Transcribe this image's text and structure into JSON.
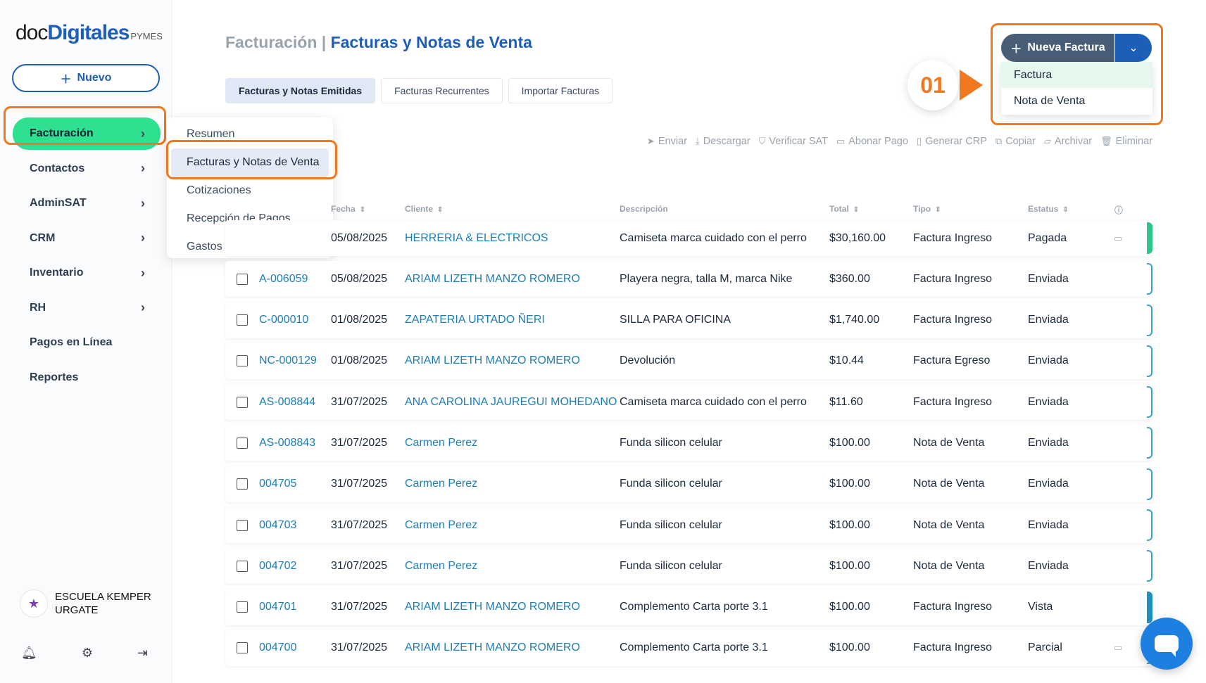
{
  "brand": {
    "pre": "doc",
    "name": "Digitales",
    "suffix": "PYMES"
  },
  "sidebar": {
    "new_button": "Nuevo",
    "items": [
      {
        "label": "Facturación",
        "active": true,
        "chevron": true
      },
      {
        "label": "Contactos",
        "chevron": true
      },
      {
        "label": "AdminSAT",
        "chevron": true
      },
      {
        "label": "CRM",
        "chevron": true
      },
      {
        "label": "Inventario",
        "chevron": true
      },
      {
        "label": "RH",
        "chevron": true
      },
      {
        "label": "Pagos en Línea",
        "chevron": false
      },
      {
        "label": "Reportes",
        "chevron": false
      }
    ],
    "org_name": "ESCUELA KEMPER URGATE",
    "bottom_icons": [
      "bell-icon",
      "gear-icon",
      "logout-icon"
    ]
  },
  "submenu": {
    "items": [
      "Resumen",
      "Facturas y Notas de Venta",
      "Cotizaciones",
      "Recepción de Pagos",
      "Gastos"
    ],
    "active": "Facturas y Notas de Venta"
  },
  "header": {
    "crumb": "Facturación",
    "separator": "|",
    "title": "Facturas y Notas de Venta"
  },
  "tabs": [
    "Facturas y Notas Emitidas",
    "Facturas Recurrentes",
    "Importar Facturas"
  ],
  "new_invoice": {
    "label": "Nueva Factura",
    "options": [
      "Factura",
      "Nota de Venta"
    ],
    "step": "01"
  },
  "toolbar": [
    "Enviar",
    "Descargar",
    "Verificar SAT",
    "Abonar Pago",
    "Generar CRP",
    "Copiar",
    "Archivar",
    "Eliminar"
  ],
  "table": {
    "headers": {
      "fecha": "Fecha",
      "cliente": "Cliente",
      "descripcion": "Descripción",
      "total": "Total",
      "tipo": "Tipo",
      "estatus": "Estatus"
    },
    "rows": [
      {
        "folio": "",
        "fecha": "05/08/2025",
        "cliente": "HERRERIA & ELECTRICOS",
        "descripcion": "Camiseta marca cuidado con el perro",
        "total": "$30,160.00",
        "tipo": "Factura Ingreso",
        "estatus": "Pagada"
      },
      {
        "folio": "A-006059",
        "fecha": "05/08/2025",
        "cliente": "ARIAM LIZETH MANZO ROMERO",
        "descripcion": "Playera negra, talla M, marca Nike",
        "total": "$360.00",
        "tipo": "Factura Ingreso",
        "estatus": "Enviada"
      },
      {
        "folio": "C-000010",
        "fecha": "01/08/2025",
        "cliente": "ZAPATERIA URTADO ÑERI",
        "descripcion": "SILLA PARA OFICINA",
        "total": "$1,740.00",
        "tipo": "Factura Ingreso",
        "estatus": "Enviada"
      },
      {
        "folio": "NC-000129",
        "fecha": "01/08/2025",
        "cliente": "ARIAM LIZETH MANZO ROMERO",
        "descripcion": "Devolución",
        "total": "$10.44",
        "tipo": "Factura Egreso",
        "estatus": "Enviada"
      },
      {
        "folio": "AS-008844",
        "fecha": "31/07/2025",
        "cliente": "ANA CAROLINA JAUREGUI MOHEDANO",
        "descripcion": "Camiseta marca cuidado con el perro",
        "total": "$11.60",
        "tipo": "Factura Ingreso",
        "estatus": "Enviada"
      },
      {
        "folio": "AS-008843",
        "fecha": "31/07/2025",
        "cliente": "Carmen Perez",
        "descripcion": "Funda silicon celular",
        "total": "$100.00",
        "tipo": "Nota de Venta",
        "estatus": "Enviada"
      },
      {
        "folio": "004705",
        "fecha": "31/07/2025",
        "cliente": "Carmen Perez",
        "descripcion": "Funda silicon celular",
        "total": "$100.00",
        "tipo": "Nota de Venta",
        "estatus": "Enviada"
      },
      {
        "folio": "004703",
        "fecha": "31/07/2025",
        "cliente": "Carmen Perez",
        "descripcion": "Funda silicon celular",
        "total": "$100.00",
        "tipo": "Nota de Venta",
        "estatus": "Enviada"
      },
      {
        "folio": "004702",
        "fecha": "31/07/2025",
        "cliente": "Carmen Perez",
        "descripcion": "Funda silicon celular",
        "total": "$100.00",
        "tipo": "Nota de Venta",
        "estatus": "Enviada"
      },
      {
        "folio": "004701",
        "fecha": "31/07/2025",
        "cliente": "ARIAM LIZETH MANZO ROMERO",
        "descripcion": "Complemento Carta porte 3.1",
        "total": "$100.00",
        "tipo": "Factura Ingreso",
        "estatus": "Vista"
      },
      {
        "folio": "004700",
        "fecha": "31/07/2025",
        "cliente": "ARIAM LIZETH MANZO ROMERO",
        "descripcion": "Complemento Carta porte 3.1",
        "total": "$100.00",
        "tipo": "Factura Ingreso",
        "estatus": "Parcial"
      }
    ]
  },
  "colors": {
    "primary": "#1d5fb8",
    "active_green": "#2ee08f",
    "highlight": "#f0781e",
    "link": "#1a7fb8"
  }
}
